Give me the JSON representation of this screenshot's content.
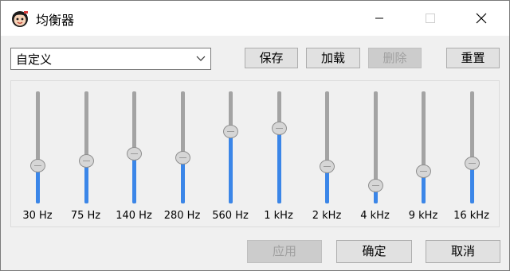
{
  "window": {
    "title": "均衡器"
  },
  "preset": {
    "selected": "自定义"
  },
  "toolbar": {
    "save_label": "保存",
    "load_label": "加载",
    "delete_label": "删除",
    "reset_label": "重置"
  },
  "bands": [
    {
      "label": "30 Hz",
      "level": 0.34
    },
    {
      "label": "75 Hz",
      "level": 0.38
    },
    {
      "label": "140 Hz",
      "level": 0.44
    },
    {
      "label": "280 Hz",
      "level": 0.41
    },
    {
      "label": "560 Hz",
      "level": 0.64
    },
    {
      "label": "1 kHz",
      "level": 0.67
    },
    {
      "label": "2 kHz",
      "level": 0.33
    },
    {
      "label": "4 kHz",
      "level": 0.16
    },
    {
      "label": "9 kHz",
      "level": 0.29
    },
    {
      "label": "16 kHz",
      "level": 0.36
    }
  ],
  "footer": {
    "apply_label": "应用",
    "ok_label": "确定",
    "cancel_label": "取消"
  },
  "colors": {
    "accent": "#3b86e8",
    "track": "#a3a3a3",
    "title_bar": "#ffffff",
    "background": "#f0f0f0"
  },
  "icons": {
    "app": "cartoon-face-icon",
    "minimize": "minimize-icon",
    "maximize": "maximize-icon",
    "close": "close-icon",
    "dropdown": "chevron-down-icon"
  }
}
